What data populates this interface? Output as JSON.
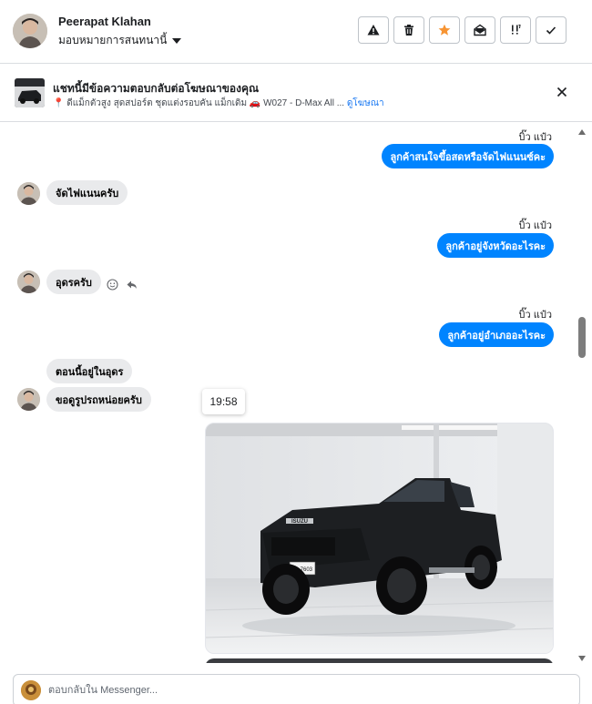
{
  "header": {
    "name": "Peerapat Klahan",
    "assign_label": "มอบหมายการสนทนานี้",
    "actions": [
      {
        "name": "warning-icon",
        "label": "Mark as spam"
      },
      {
        "name": "trash-icon",
        "label": "Delete"
      },
      {
        "name": "star-icon",
        "label": "Star"
      },
      {
        "name": "mark-unread-icon",
        "label": "Mark unread"
      },
      {
        "name": "follow-up-icon",
        "label": "Follow up"
      },
      {
        "name": "check-icon",
        "label": "Mark done"
      }
    ],
    "star_color": "#f79432"
  },
  "ad_banner": {
    "title": "แชทนี้มีข้อความตอบกลับต่อโฆษณาของคุณ",
    "subtitle": "📍 ดีแม็กตัวสูง สุดสปอร์ต ชุดแต่งรอบคัน แม็กเดิม 🚗 W027 - D-Max All ...",
    "link": "ดูโฆษณา",
    "link_color": "#1877f2"
  },
  "messages": [
    {
      "side": "out",
      "sender": "บิ๊ว แป๋ว",
      "text": "ลูกค้าสนใจขึ้อสดหรือจัดไฟแนนซ์คะ"
    },
    {
      "side": "in",
      "text": "จัดไฟแนนครับ"
    },
    {
      "side": "out",
      "sender": "บิ๊ว แป๋ว",
      "text": "ลูกค้าอยู่จังหวัดอะไรคะ"
    },
    {
      "side": "in",
      "text": "อุดรครับ"
    },
    {
      "side": "out",
      "sender": "บิ๊ว แป๋ว",
      "text": "ลูกค้าอยู่อำเภออะไรคะ"
    },
    {
      "side": "in",
      "text": "ตอนนี้อยู่ในอุดร"
    },
    {
      "side": "in",
      "text": "ขอดูรูปรถหน่อยครับ"
    }
  ],
  "timestamp_tooltip": "19:58",
  "photo": {
    "brand_text": "ISUZU",
    "plate_text": "ขง 7603"
  },
  "bubble_colors": {
    "out": "#0084ff",
    "in": "#e9eaec"
  },
  "reply": {
    "placeholder": "ตอบกลับใน Messenger..."
  }
}
